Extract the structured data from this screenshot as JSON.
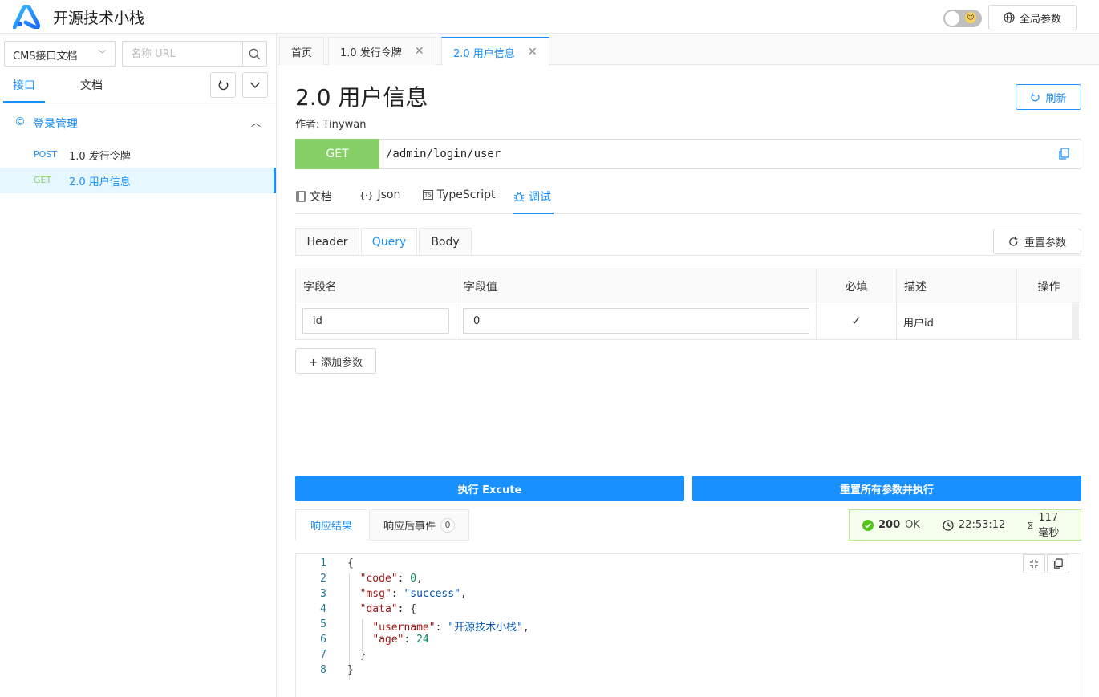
{
  "app": {
    "title": "开源技术小栈",
    "global_params": "全局参数"
  },
  "sidebar": {
    "project": "CMS接口文档",
    "search_placeholder": "名称 URL",
    "tabs": [
      "接口",
      "文档"
    ],
    "group": {
      "label": "登录管理",
      "icon": "copyright-icon"
    },
    "items": [
      {
        "method": "POST",
        "name": "1.0 发行令牌",
        "method_color": "#1890ff"
      },
      {
        "method": "GET",
        "name": "2.0 用户信息",
        "method_color": "#87d068"
      }
    ]
  },
  "tabs": [
    {
      "label": "首页"
    },
    {
      "label": "1.0 发行令牌"
    },
    {
      "label": "2.0 用户信息"
    }
  ],
  "page": {
    "title": "2.0 用户信息",
    "author": "作者: Tinywan",
    "refresh": "刷新",
    "method": "GET",
    "url": "/admin/login/user"
  },
  "doc_tabs": [
    "文档",
    "Json",
    "TypeScript",
    "调试"
  ],
  "param_tabs": [
    "Header",
    "Query",
    "Body"
  ],
  "reset_params": "重置参数",
  "param_table": {
    "headers": [
      "字段名",
      "字段值",
      "必填",
      "描述",
      "操作"
    ],
    "rows": [
      {
        "name": "id",
        "value": "0",
        "required": "✓",
        "desc": "用户id"
      }
    ]
  },
  "add_param": "+ 添加参数",
  "execute": "执行 Excute",
  "reset_execute": "重置所有参数并执行",
  "response_tabs": {
    "result": "响应结果",
    "events": "响应后事件",
    "events_count": "0"
  },
  "status": {
    "code": "200",
    "text": "OK",
    "time": "22:53:12",
    "duration": "117毫秒"
  },
  "response_lines": [
    "{",
    "  \"code\": 0,",
    "  \"msg\": \"success\",",
    "  \"data\": {",
    "    \"username\": \"开源技术小栈\",",
    "    \"age\": 24",
    "  }",
    "}"
  ],
  "colors": {
    "accent": "#1890ff",
    "get": "#87d068",
    "success": "#52c41a"
  }
}
